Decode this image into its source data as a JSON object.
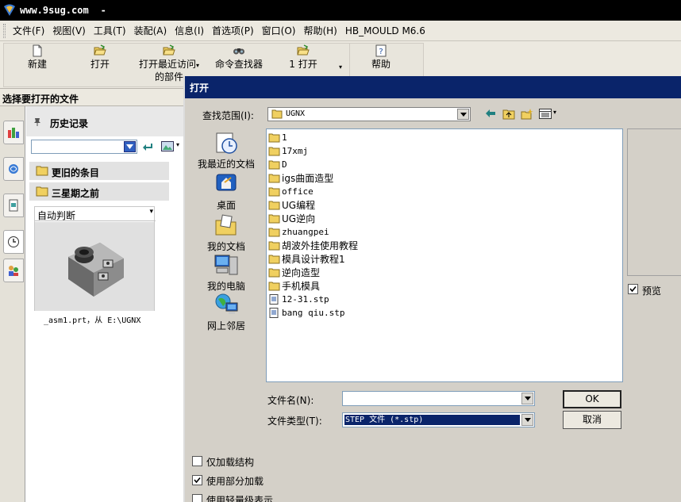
{
  "window": {
    "title": "www.9sug.com",
    "title_suffix": "-"
  },
  "menu": [
    "文件(F)",
    "视图(V)",
    "工具(T)",
    "装配(A)",
    "信息(I)",
    "首选项(P)",
    "窗口(O)",
    "帮助(H)",
    "HB_MOULD M6.6"
  ],
  "toolbar": {
    "new": "新建",
    "open": "打开",
    "recent_line1": "打开最近访问",
    "recent_line2": "的部件",
    "command_finder": "命令查找器",
    "open_one": "1 打开",
    "help": "帮助"
  },
  "left_panel": {
    "header": "选择要打开的文件",
    "history_title": "历史记录",
    "search_value": "",
    "group_older": "更旧的条目",
    "group_three_weeks": "三星期之前",
    "view_select": "自动判断",
    "history_file": "_asm1.prt，从 E:\\UGNX"
  },
  "dialog": {
    "title": "打开",
    "look_in_label": "查找范围(I):",
    "look_in_value": "UGNX",
    "places": [
      "我最近的文档",
      "桌面",
      "我的文档",
      "我的电脑",
      "网上邻居"
    ],
    "files": [
      {
        "name": "1",
        "type": "folder"
      },
      {
        "name": "17xmj",
        "type": "folder"
      },
      {
        "name": "D",
        "type": "folder"
      },
      {
        "name": "igs曲面造型",
        "type": "folder"
      },
      {
        "name": "office",
        "type": "folder"
      },
      {
        "name": "UG编程",
        "type": "folder"
      },
      {
        "name": "UG逆向",
        "type": "folder"
      },
      {
        "name": "zhuangpei",
        "type": "folder"
      },
      {
        "name": "胡波外挂使用教程",
        "type": "folder"
      },
      {
        "name": "模具设计教程1",
        "type": "folder"
      },
      {
        "name": "逆向造型",
        "type": "folder"
      },
      {
        "name": "手机模具",
        "type": "folder"
      },
      {
        "name": "12-31.stp",
        "type": "file"
      },
      {
        "name": "bang qiu.stp",
        "type": "file"
      }
    ],
    "preview_label": "预览",
    "filename_label": "文件名(N):",
    "filename_value": "",
    "filetype_label": "文件类型(T):",
    "filetype_value": "STEP 文件 (*.stp)",
    "ok": "OK",
    "cancel": "取消",
    "opt_structure_only": "仅加载结构",
    "opt_partial_load": "使用部分加载",
    "opt_lightweight": "使用轻量级表示"
  },
  "colors": {
    "title_bar": "#000000",
    "dialog_title": "#0a246a",
    "selection": "#0a246a",
    "folder": "#f0d060"
  }
}
